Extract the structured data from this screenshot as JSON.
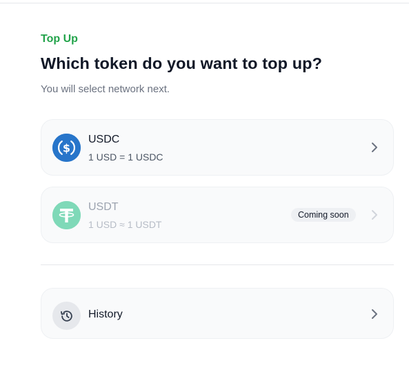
{
  "header": {
    "eyebrow": "Top Up",
    "title": "Which token do you want to top up?",
    "subtitle": "You will select network next."
  },
  "tokens": [
    {
      "name": "USDC",
      "rate": "1 USD = 1 USDC",
      "icon": "usdc-icon",
      "color": "#2775ca",
      "disabled": false
    },
    {
      "name": "USDT",
      "rate": "1 USD ≈ 1 USDT",
      "icon": "usdt-icon",
      "color": "#7fd9b8",
      "disabled": true,
      "badge": "Coming soon"
    }
  ],
  "history": {
    "label": "History",
    "icon": "history-icon"
  },
  "colors": {
    "accent_green": "#22a34a",
    "card_bg": "#f9fafb",
    "text_primary": "#111827",
    "text_muted": "#6b7280"
  }
}
